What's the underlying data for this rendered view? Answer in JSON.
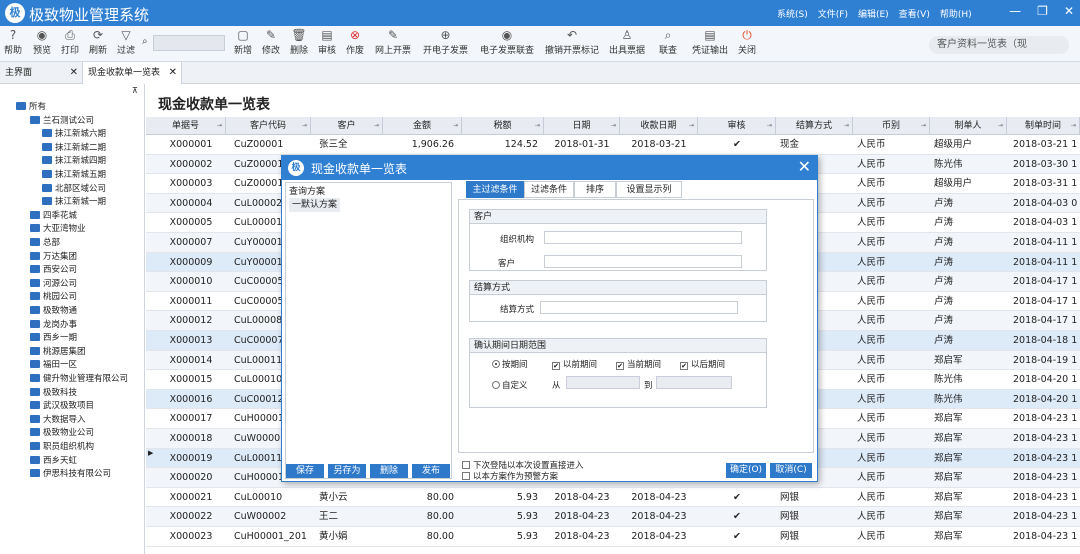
{
  "app": {
    "logo": "极",
    "title": "极致物业管理系统"
  },
  "menus": [
    "系统(S)",
    "文件(F)",
    "编辑(E)",
    "查看(V)",
    "帮助(H)"
  ],
  "window_controls": {
    "minimize": "—",
    "restore": "❐",
    "close": "✕"
  },
  "toolbar": {
    "items": [
      {
        "label": "帮助",
        "icon": "?"
      },
      {
        "label": "预览",
        "icon": "◉"
      },
      {
        "label": "打印",
        "icon": "⎙"
      },
      {
        "label": "刷新",
        "icon": "⟳"
      },
      {
        "label": "过滤",
        "icon": "▽"
      },
      {
        "label": "新增",
        "icon": "▢"
      },
      {
        "label": "修改",
        "icon": "✎"
      },
      {
        "label": "删除",
        "icon": "🗑"
      },
      {
        "label": "审核",
        "icon": "▤"
      },
      {
        "label": "作废",
        "icon": "⊗"
      },
      {
        "label": "网上开票",
        "icon": "✎"
      },
      {
        "label": "开电子发票",
        "icon": "⊕"
      },
      {
        "label": "电子发票联查",
        "icon": "◉"
      },
      {
        "label": "撤销开票标记",
        "icon": "↶"
      },
      {
        "label": "出具票据",
        "icon": "♙"
      },
      {
        "label": "联查",
        "icon": "⌕"
      },
      {
        "label": "凭证输出",
        "icon": "▤"
      },
      {
        "label": "关闭",
        "icon": "⏻"
      }
    ],
    "search_icon": "⌕",
    "right_search": "客户资料一览表（现"
  },
  "tabs": [
    {
      "label": "主界面",
      "close": "✕"
    },
    {
      "label": "现金收款单一览表",
      "close": "✕"
    }
  ],
  "tree": {
    "pin": "⊼",
    "nodes": [
      {
        "label": "所有",
        "level": 0
      },
      {
        "label": "兰石测试公司",
        "level": 1
      },
      {
        "label": "抹江新城六期",
        "level": 2
      },
      {
        "label": "抹江新城二期",
        "level": 2
      },
      {
        "label": "抹江新城四期",
        "level": 2
      },
      {
        "label": "抹江新城五期",
        "level": 2
      },
      {
        "label": "北部区域公司",
        "level": 2
      },
      {
        "label": "抹江新城一期",
        "level": 2
      },
      {
        "label": "四季花城",
        "level": 1
      },
      {
        "label": "大亚湾物业",
        "level": 1
      },
      {
        "label": "总部",
        "level": 1
      },
      {
        "label": "万达集团",
        "level": 1
      },
      {
        "label": "西安公司",
        "level": 1
      },
      {
        "label": "河源公司",
        "level": 1
      },
      {
        "label": "桃园公司",
        "level": 1
      },
      {
        "label": "极致物通",
        "level": 1
      },
      {
        "label": "龙岗办事",
        "level": 1
      },
      {
        "label": "西乡一期",
        "level": 1
      },
      {
        "label": "桃源居集团",
        "level": 1
      },
      {
        "label": "福田一区",
        "level": 1
      },
      {
        "label": "健升物业管理有限公司",
        "level": 1
      },
      {
        "label": "极致科技",
        "level": 1
      },
      {
        "label": "武汉极致项目",
        "level": 1
      },
      {
        "label": "大数据导入",
        "level": 1
      },
      {
        "label": "极致物业公司",
        "level": 1
      },
      {
        "label": "职员组织机构",
        "level": 1
      },
      {
        "label": "西乡天虹",
        "level": 1
      },
      {
        "label": "伊思科技有限公司",
        "level": 1
      }
    ]
  },
  "page_title": "现金收款单一览表",
  "grid": {
    "sort_glyph": "⇥",
    "columns": [
      "单据号",
      "客户代码",
      "客户",
      "金额",
      "税额",
      "日期",
      "收款日期",
      "审核",
      "结算方式",
      "币别",
      "制单人",
      "制单时间"
    ],
    "rows": [
      [
        "X000001",
        "CuZ00001",
        "张三全",
        "1,906.26",
        "124.52",
        "2018-01-31",
        "2018-03-21",
        "✔",
        "现金",
        "人民币",
        "超级用户",
        "2018-03-21 1"
      ],
      [
        "X000002",
        "CuZ00001",
        "",
        "",
        "",
        "",
        "",
        "",
        "",
        "人民币",
        "陈光伟",
        "2018-03-30 1"
      ],
      [
        "X000003",
        "CuZ00001",
        "",
        "",
        "",
        "",
        "",
        "",
        "",
        "人民币",
        "超级用户",
        "2018-03-31 1"
      ],
      [
        "X000004",
        "CuL00002",
        "",
        "",
        "",
        "",
        "",
        "",
        "",
        "人民币",
        "卢涛",
        "2018-04-03 0"
      ],
      [
        "X000005",
        "CuL00001",
        "",
        "",
        "",
        "",
        "",
        "",
        "",
        "人民币",
        "卢涛",
        "2018-04-03 1"
      ],
      [
        "X000007",
        "CuY00001",
        "",
        "",
        "",
        "",
        "",
        "",
        "",
        "人民币",
        "卢涛",
        "2018-04-11 1"
      ],
      [
        "X000009",
        "CuY00001",
        "",
        "",
        "",
        "",
        "",
        "",
        "",
        "人民币",
        "卢涛",
        "2018-04-11 1"
      ],
      [
        "X000010",
        "CuC00005",
        "",
        "",
        "",
        "",
        "",
        "",
        "",
        "人民币",
        "卢涛",
        "2018-04-17 1"
      ],
      [
        "X000011",
        "CuC00005",
        "",
        "",
        "",
        "",
        "",
        "",
        "",
        "人民币",
        "卢涛",
        "2018-04-17 1"
      ],
      [
        "X000012",
        "CuL00008",
        "",
        "",
        "",
        "",
        "",
        "",
        "",
        "人民币",
        "卢涛",
        "2018-04-17 1"
      ],
      [
        "X000013",
        "CuC00007",
        "",
        "",
        "",
        "",
        "",
        "",
        "",
        "人民币",
        "卢涛",
        "2018-04-18 1"
      ],
      [
        "X000014",
        "CuL00011",
        "",
        "",
        "",
        "",
        "",
        "",
        "",
        "人民币",
        "郑启军",
        "2018-04-19 1"
      ],
      [
        "X000015",
        "CuL00010",
        "",
        "",
        "",
        "",
        "",
        "",
        "",
        "人民币",
        "陈光伟",
        "2018-04-20 1"
      ],
      [
        "X000016",
        "CuC00012",
        "",
        "",
        "",
        "",
        "",
        "",
        "",
        "人民币",
        "陈光伟",
        "2018-04-20 1"
      ],
      [
        "X000017",
        "CuH00001",
        "",
        "",
        "",
        "",
        "",
        "",
        "",
        "人民币",
        "郑启军",
        "2018-04-23 1"
      ],
      [
        "X000018",
        "CuW0000:",
        "",
        "",
        "",
        "",
        "",
        "",
        "",
        "人民币",
        "郑启军",
        "2018-04-23 1"
      ],
      [
        "X000019",
        "CuL00011",
        "",
        "",
        "",
        "",
        "",
        "",
        "",
        "人民币",
        "郑启军",
        "2018-04-23 1"
      ],
      [
        "X000020",
        "CuH00001",
        "",
        "",
        "",
        "",
        "",
        "",
        "",
        "人民币",
        "郑启军",
        "2018-04-23 1"
      ],
      [
        "X000021",
        "CuL00010",
        "黄小云",
        "80.00",
        "5.93",
        "2018-04-23",
        "2018-04-23",
        "✔",
        "网银",
        "人民币",
        "郑启军",
        "2018-04-23 1"
      ],
      [
        "X000022",
        "CuW00002",
        "王二",
        "80.00",
        "5.93",
        "2018-04-23",
        "2018-04-23",
        "✔",
        "网银",
        "人民币",
        "郑启军",
        "2018-04-23 1"
      ],
      [
        "X000023",
        "CuH00001_201",
        "黄小娟",
        "80.00",
        "5.93",
        "2018-04-23",
        "2018-04-23",
        "✔",
        "网银",
        "人民币",
        "郑启军",
        "2018-04-23 1"
      ]
    ],
    "current_row_marker": "▶"
  },
  "dialog": {
    "logo": "极",
    "title": "现金收款单一览表",
    "close": "✕",
    "schemes_title": "查询方案",
    "default_scheme": "一默认方案",
    "scheme_buttons": [
      "保存",
      "另存为",
      "删除",
      "发布"
    ],
    "tabs": [
      "主过滤条件",
      "过滤条件",
      "排序",
      "设置显示列"
    ],
    "customer_group": "客户",
    "org_label": "组织机构",
    "customer_label": "客户",
    "settle_group": "结算方式",
    "settle_label": "结算方式",
    "period_group": "确认期间日期范围",
    "by_period": "按期间",
    "prev_periods": "以前期间",
    "current_period": "当前期间",
    "later_periods": "以后期间",
    "custom": "自定义",
    "from_label": "从",
    "to_label": "到",
    "skip_next": "下次登陆以本次设置直接进入",
    "as_default": "以本方案作为预警方案",
    "ok": "确定(O)",
    "cancel": "取消(C)",
    "check_mark": "✔"
  }
}
